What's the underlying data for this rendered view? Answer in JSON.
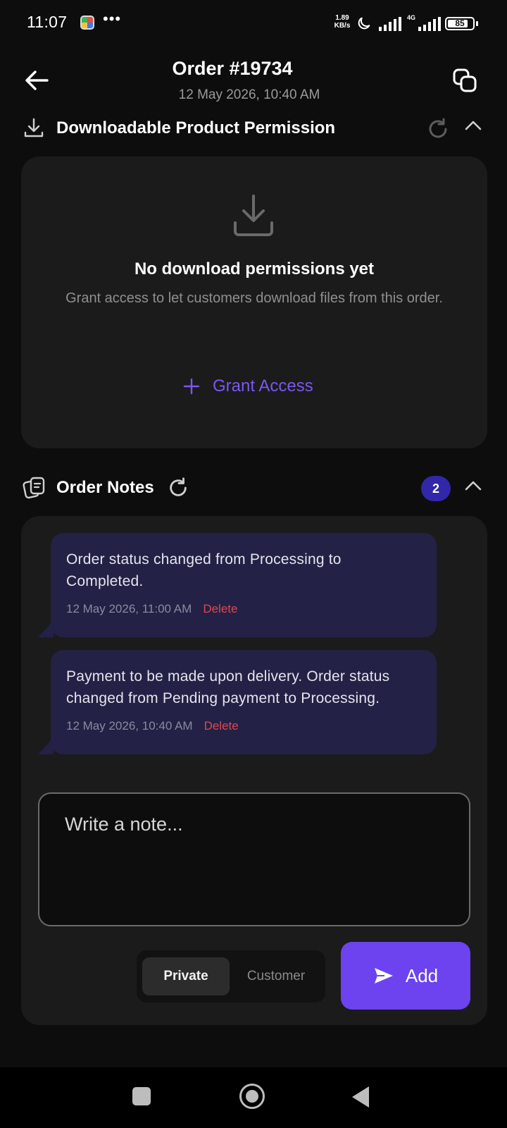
{
  "status_bar": {
    "time": "11:07",
    "dots": "•••",
    "net_speed_value": "1.89",
    "net_speed_unit": "KB/s",
    "network_type": "4G",
    "battery": "85",
    "battery_level": 0.85
  },
  "header": {
    "title": "Order #19734",
    "subtitle": "12 May 2026, 10:40 AM",
    "back_icon": "arrow-left-icon",
    "copy_icon": "copy-icon"
  },
  "download_section": {
    "title": "Downloadable Product Permission",
    "icon": "download-icon",
    "empty_title": "No download permissions yet",
    "empty_desc": "Grant access to let customers download files from this order.",
    "grant_label": "Grant Access",
    "grant_icon": "plus-icon"
  },
  "notes_section": {
    "title": "Order Notes",
    "icon": "notes-icon",
    "count": "2",
    "notes": [
      {
        "text": "Order status changed from Processing to Completed.",
        "date": "12 May 2026, 11:00 AM",
        "delete_label": "Delete"
      },
      {
        "text": "Payment to be made upon delivery. Order status changed from Pending payment to Processing.",
        "date": "12 May 2026, 10:40 AM",
        "delete_label": "Delete"
      }
    ],
    "input_placeholder": "Write a note...",
    "toggle": {
      "private_label": "Private",
      "customer_label": "Customer",
      "selected": "Private"
    },
    "add_label": "Add",
    "add_icon": "send-icon"
  },
  "colors": {
    "accent": "#6c43ef",
    "accent_text": "#7b57f0",
    "badge": "#3127a8",
    "note_bg": "#232145",
    "danger": "#e0474f",
    "card_bg": "#1b1b1b",
    "page_bg": "#0d0d0d"
  }
}
